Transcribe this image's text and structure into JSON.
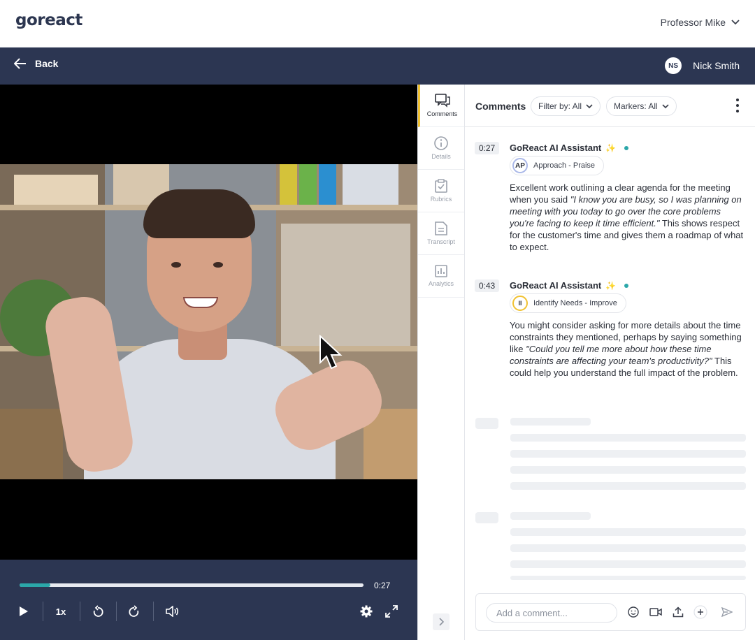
{
  "header": {
    "logo_text": "goreact",
    "user_name": "Professor Mike"
  },
  "nav": {
    "back_label": "Back",
    "student_initials": "NS",
    "student_name": "Nick Smith"
  },
  "player": {
    "progress_fraction": 0.09,
    "current_time": "0:27",
    "speed_label": "1x"
  },
  "tabs": [
    {
      "label": "Comments",
      "icon": "comments-icon",
      "active": true
    },
    {
      "label": "Details",
      "icon": "info-icon",
      "active": false
    },
    {
      "label": "Rubrics",
      "icon": "rubric-clipboard-icon",
      "active": false
    },
    {
      "label": "Transcript",
      "icon": "transcript-document-icon",
      "active": false
    },
    {
      "label": "Analytics",
      "icon": "analytics-chart-icon",
      "active": false
    }
  ],
  "panel": {
    "title": "Comments",
    "filter_label": "Filter by: All",
    "markers_label": "Markers: All"
  },
  "comments": [
    {
      "timestamp": "0:27",
      "author": "GoReact AI Assistant",
      "sparkle": "✨",
      "marker_abbr": "AP",
      "marker_label": "Approach - Praise",
      "body_before": "Excellent work outlining a clear agenda for the meeting when you said ",
      "body_quote": "\"I know you are busy, so I was planning on meeting with you today to go over the core problems you're facing to keep it time efficient.\"",
      "body_after": " This shows respect for the customer's time and gives them a roadmap of what to expect."
    },
    {
      "timestamp": "0:43",
      "author": "GoReact AI Assistant",
      "sparkle": "✨",
      "marker_abbr": "II",
      "marker_label": "Identify Needs - Improve",
      "body_before": "You might consider asking for more details about the time constraints they mentioned, perhaps by saying something like ",
      "body_quote": "\"Could you tell me more about how these time constraints are affecting your team's productivity?\"",
      "body_after": " This could help you understand the full impact of the problem."
    }
  ],
  "composer": {
    "placeholder": "Add a comment..."
  },
  "colors": {
    "navy": "#2c3652",
    "accent_teal": "#2ba7a9",
    "active_tab_yellow": "#f1c232"
  }
}
